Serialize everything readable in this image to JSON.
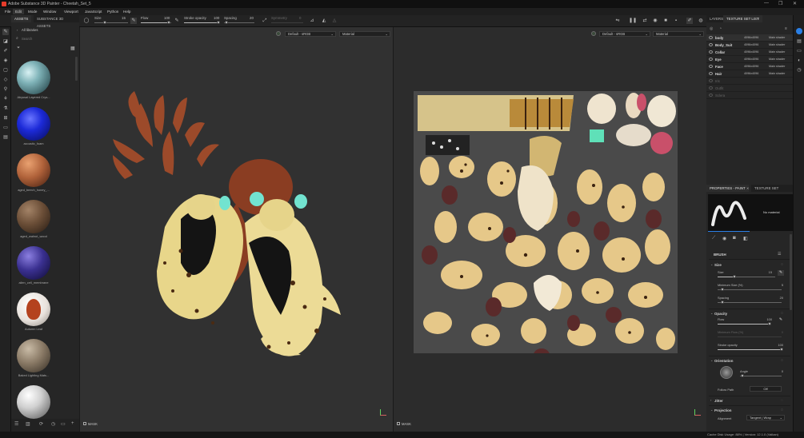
{
  "window": {
    "title": "Adobe Substance 3D Painter - Cheetah_Set_5",
    "controls": [
      "—",
      "❐",
      "✕"
    ]
  },
  "menu": [
    "File",
    "Edit",
    "Mode",
    "Window",
    "Viewport",
    "JavaScript",
    "Python",
    "Help"
  ],
  "toolbar": {
    "size_label": "Size",
    "size_value": "15",
    "flow_label": "Flow",
    "flow_value": "100",
    "stroke_opacity_label": "Stroke opacity",
    "stroke_opacity_value": "100",
    "spacing_label": "Spacing",
    "spacing_value": "20",
    "symmetry_label": "Symmetry",
    "symmetry_value": "0"
  },
  "assets_panel": {
    "tabs": [
      "ASSETS",
      "SUBSTANCE 3D ASSETS"
    ],
    "breadcrumb": "All libraries",
    "search_placeholder": "Search",
    "items": [
      {
        "label": "Abyssal Layered Crys...",
        "color": "#7fb3b8"
      },
      {
        "label": "acoustic_foam",
        "color": "#1c2ad8"
      },
      {
        "label": "aged_beech_honey_...",
        "color": "#b0623a"
      },
      {
        "label": "aged_walnut_wood",
        "color": "#6b4e37"
      },
      {
        "label": "alien_cell_membrane",
        "color": "#3a3090"
      },
      {
        "label": "Autumn Leaf",
        "color": "#e8e2dc"
      },
      {
        "label": "Baked Lighting Mats...",
        "color": "#8a7a66"
      },
      {
        "label": "",
        "color": "#d0d0d0"
      }
    ]
  },
  "viewport_3d": {
    "colorspace": "Default - sRGB",
    "mode": "Material",
    "mask_label": "MASK"
  },
  "viewport_2d": {
    "colorspace": "Default - sRGB",
    "mode": "Material",
    "mask_label": "MASK"
  },
  "layers_panel": {
    "tabs": [
      "LAYERS",
      "TEXTURE SET LIST"
    ],
    "rows": [
      {
        "name": "body",
        "size": "4096x4096",
        "shader": "Main shader",
        "enabled": true
      },
      {
        "name": "Body_Suit",
        "size": "4096x4096",
        "shader": "Main shader",
        "enabled": true
      },
      {
        "name": "Collar",
        "size": "4096x4096",
        "shader": "Main shader",
        "enabled": true
      },
      {
        "name": "Eye",
        "size": "4096x4096",
        "shader": "Main shader",
        "enabled": true
      },
      {
        "name": "Face",
        "size": "4096x4096",
        "shader": "Main shader",
        "enabled": true
      },
      {
        "name": "Hair",
        "size": "4096x4096",
        "shader": "Main shader",
        "enabled": true
      },
      {
        "name": "Iris",
        "size": "",
        "shader": "",
        "enabled": false
      },
      {
        "name": "Outfit",
        "size": "",
        "shader": "",
        "enabled": false
      },
      {
        "name": "Sclera",
        "size": "",
        "shader": "",
        "enabled": false
      }
    ]
  },
  "properties_panel": {
    "tabs": [
      "PROPERTIES - PAINT",
      "TEXTURE SET SETTINGS"
    ],
    "material_label": "No material",
    "brush_title": "BRUSH",
    "size_section": "Size",
    "size_label": "Size",
    "size_value": "15",
    "min_size_label": "Minimum Size (%)",
    "min_size_value": "5",
    "spacing_label": "Spacing",
    "spacing_value": "20",
    "opacity_section": "Opacity",
    "flow_label": "Flow",
    "flow_value": "100",
    "min_flow_label": "Minimum Flow (%)",
    "min_flow_value": "0",
    "stroke_opacity_label": "Stroke opacity",
    "stroke_opacity_value": "100",
    "orientation_section": "Orientation",
    "angle_label": "Angle",
    "angle_value": "0",
    "follow_path_label": "Follow Path",
    "follow_path_value": "Off",
    "jitter_section": "Jitter",
    "projection_section": "Projection",
    "alignment_label": "Alignment",
    "alignment_value": "Tangent | Wrap"
  },
  "status": {
    "text": "Cache Disk Usage:  88% | Version: 12.1.0 (Valkan)"
  }
}
